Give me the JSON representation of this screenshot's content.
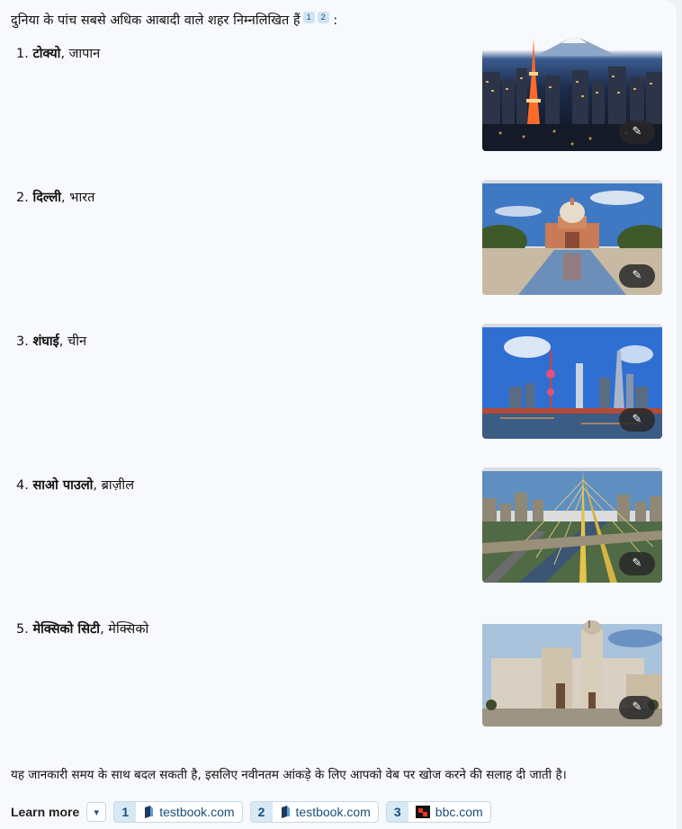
{
  "intro": {
    "text": "दुनिया के पांच सबसे अधिक आबादी वाले शहर निम्नलिखित हैं",
    "cites": [
      "1",
      "2"
    ],
    "suffix": " :"
  },
  "cities": [
    {
      "num": "1.",
      "name": "टोक्यो",
      "country": ", जापान"
    },
    {
      "num": "2.",
      "name": "दिल्ली",
      "country": ", भारत"
    },
    {
      "num": "3.",
      "name": "शंघाई",
      "country": ", चीन"
    },
    {
      "num": "4.",
      "name": "साओ पाउलो",
      "country": ", ब्राज़ील"
    },
    {
      "num": "5.",
      "name": "मेक्सिको सिटी",
      "country": ", मेक्सिको"
    }
  ],
  "image_action_icon": "magic-wand-icon",
  "footer": "यह जानकारी समय के साथ बदल सकती है, इसलिए नवीनतम आंकड़े के लिए आपको वेब पर खोज करने की सलाह दी जाती है।",
  "learn_more": {
    "label": "Learn more",
    "sources": [
      {
        "num": "1",
        "domain": "testbook.com",
        "icon": "testbook-icon"
      },
      {
        "num": "2",
        "domain": "testbook.com",
        "icon": "testbook-icon"
      },
      {
        "num": "3",
        "domain": "bbc.com",
        "icon": "bbc-icon"
      }
    ]
  }
}
